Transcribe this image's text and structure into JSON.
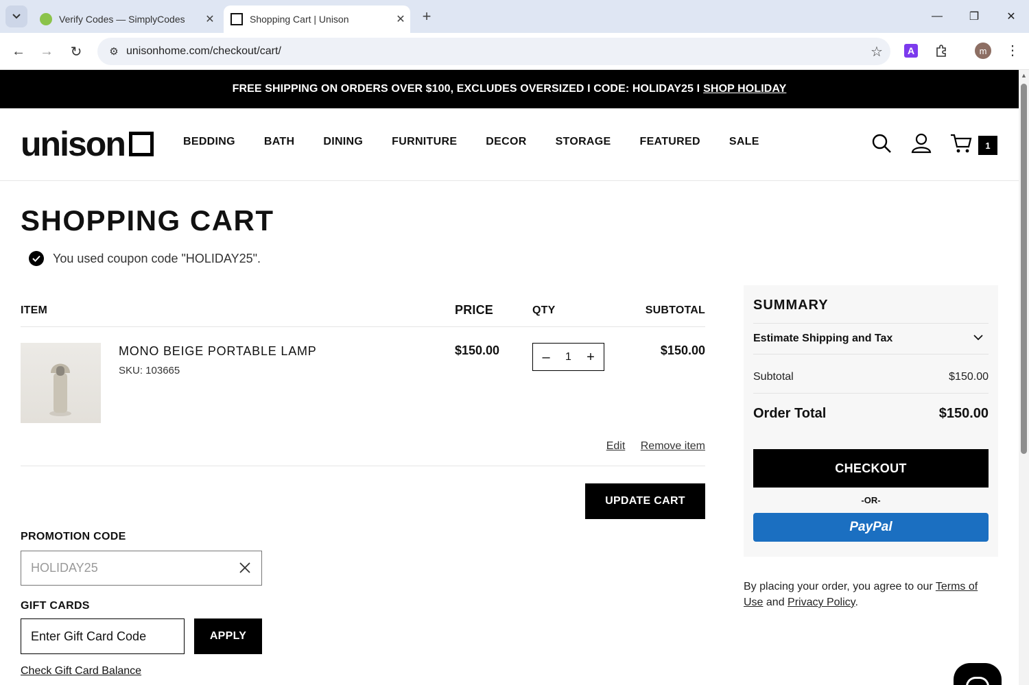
{
  "browser": {
    "tabs": [
      {
        "title": "Verify Codes — SimplyCodes",
        "active": false,
        "favicon": "simplycodes-leaf-icon"
      },
      {
        "title": "Shopping Cart | Unison",
        "active": true,
        "favicon": "unison-square-icon"
      }
    ],
    "url": "unisonhome.com/checkout/cart/",
    "profile_initial": "m",
    "extension_label": "A"
  },
  "promo_bar": {
    "text": "FREE SHIPPING ON ORDERS OVER $100, EXCLUDES OVERSIZED I CODE: HOLIDAY25 I",
    "link": "SHOP HOLIDAY"
  },
  "header": {
    "logo": "unison",
    "nav": [
      "BEDDING",
      "BATH",
      "DINING",
      "FURNITURE",
      "DECOR",
      "STORAGE",
      "FEATURED",
      "SALE"
    ],
    "cart_count": "1"
  },
  "cart": {
    "title": "SHOPPING CART",
    "coupon_message": "You used coupon code \"HOLIDAY25\".",
    "columns": {
      "item": "ITEM",
      "price": "PRICE",
      "qty": "QTY",
      "subtotal": "SUBTOTAL"
    },
    "items": [
      {
        "name": "MONO BEIGE PORTABLE LAMP",
        "sku": "SKU: 103665",
        "price": "$150.00",
        "qty": "1",
        "subtotal": "$150.00",
        "edit_label": "Edit",
        "remove_label": "Remove item"
      }
    ],
    "update_label": "UPDATE CART"
  },
  "promotion": {
    "label": "PROMOTION CODE",
    "value": "HOLIDAY25"
  },
  "gift_cards": {
    "label": "GIFT CARDS",
    "placeholder": "Enter Gift Card Code",
    "apply_label": "APPLY",
    "balance_link": "Check Gift Card Balance"
  },
  "summary": {
    "title": "SUMMARY",
    "estimate_label": "Estimate Shipping and Tax",
    "subtotal_label": "Subtotal",
    "subtotal_value": "$150.00",
    "total_label": "Order Total",
    "total_value": "$150.00",
    "checkout_label": "CHECKOUT",
    "or_label": "-OR-",
    "paypal_label": "PayPal"
  },
  "legal": {
    "prefix": "By placing your order, you agree to our ",
    "terms": "Terms of Use",
    "middle": " and ",
    "privacy": "Privacy Policy",
    "suffix": "."
  },
  "colors": {
    "paypal": "#1b6fc1",
    "promo_bar": "#000000",
    "summary_bg": "#f7f7f7"
  }
}
